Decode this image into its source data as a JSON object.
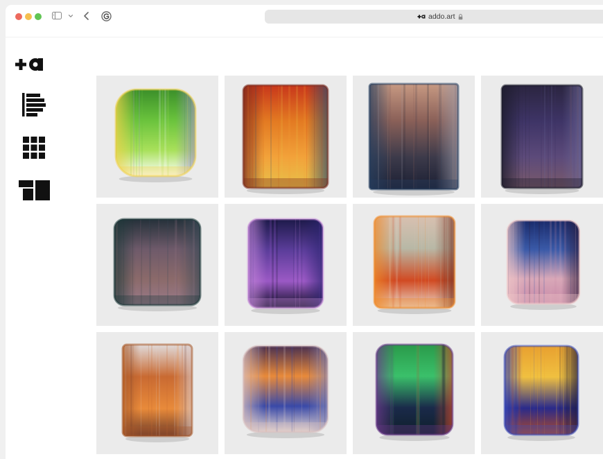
{
  "browser": {
    "url_display": "addo.art",
    "favicon": "addo-plus-a-icon",
    "lock": "lock-icon"
  },
  "nav": {
    "logo": "addo-plus-a-logo",
    "items": [
      {
        "icon": "list-view-icon"
      },
      {
        "icon": "grid-view-icon"
      },
      {
        "icon": "mosaic-view-icon"
      }
    ]
  },
  "gallery": {
    "tiles": [
      {
        "palette": [
          "#3b8f2a",
          "#69c23c",
          "#a8e05a",
          "#f0d24a",
          "#9a8fc6",
          "#ffffff"
        ]
      },
      {
        "palette": [
          "#c8371b",
          "#e37a22",
          "#f2a23a",
          "#7a2a1e",
          "#2a4c6e",
          "#e8c04a"
        ]
      },
      {
        "palette": [
          "#c79982",
          "#8a6058",
          "#3c3a4a",
          "#274060",
          "#9a9aa8",
          "#1b1f33"
        ]
      },
      {
        "palette": [
          "#2b2540",
          "#3e3466",
          "#5c4a7a",
          "#1b1b2a",
          "#6c6a9a",
          "#7a5a6a"
        ]
      },
      {
        "palette": [
          "#25313a",
          "#6e5a6a",
          "#8b6a6a",
          "#1e3a3a",
          "#3a4a56",
          "#9a7a8a"
        ]
      },
      {
        "palette": [
          "#1d1a4a",
          "#5b3d9a",
          "#9b59c5",
          "#c68ad8",
          "#2a2470",
          "#0f0f26"
        ]
      },
      {
        "palette": [
          "#d8c0b0",
          "#b8b8a6",
          "#d14a22",
          "#f08a28",
          "#7a3a2a",
          "#e8d6c6"
        ]
      },
      {
        "palette": [
          "#1a2a6a",
          "#3a5aa8",
          "#d9a8b8",
          "#f0c8c8",
          "#2a1a3a",
          "#c88aa8"
        ]
      },
      {
        "palette": [
          "#e0dada",
          "#c96a32",
          "#e88a3a",
          "#a85a2a",
          "#d8c8c8",
          "#6a3a2a"
        ]
      },
      {
        "palette": [
          "#4a3050",
          "#e88a3a",
          "#3a4aa8",
          "#d8c0c0",
          "#8a8ab8",
          "#e8d8d0"
        ]
      },
      {
        "palette": [
          "#2a9a4a",
          "#3ac06a",
          "#1a2a4a",
          "#6a3a8a",
          "#c84a2a",
          "#0f1f2a"
        ]
      },
      {
        "palette": [
          "#e8a030",
          "#f0c040",
          "#2a2a8a",
          "#3a4ab8",
          "#1a1a3a",
          "#b04a2a"
        ]
      }
    ]
  }
}
